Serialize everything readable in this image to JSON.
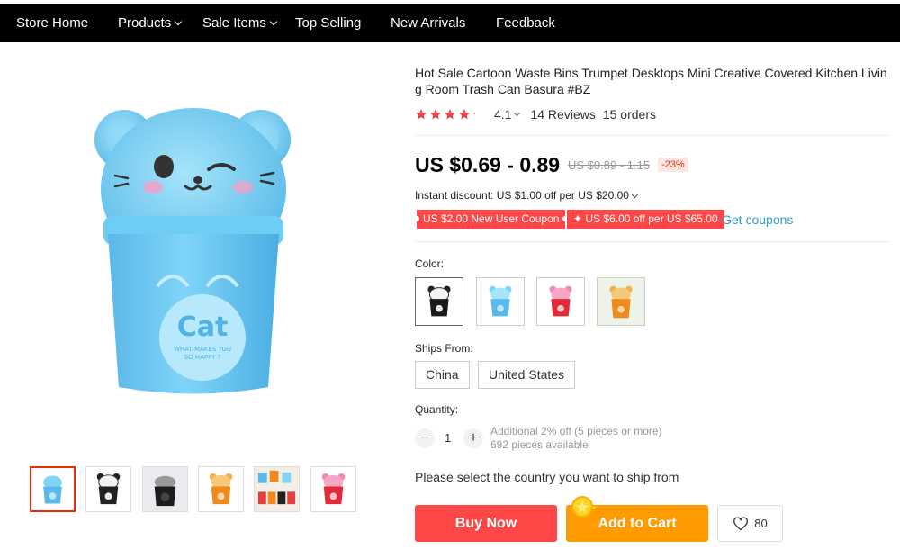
{
  "nav": {
    "items": [
      {
        "label": "Store Home",
        "dropdown": false
      },
      {
        "label": "Products",
        "dropdown": true
      },
      {
        "label": "Sale Items",
        "dropdown": true
      },
      {
        "label": "Top Selling",
        "dropdown": false
      },
      {
        "label": "New Arrivals",
        "dropdown": false
      },
      {
        "label": "Feedback",
        "dropdown": false
      }
    ]
  },
  "product": {
    "title": "Hot Sale Cartoon Waste Bins Trumpet Desktops Mini Creative Covered Kitchen Living Room Trash Can Basura #BZ",
    "rating": "4.1",
    "reviews": "14 Reviews",
    "orders": "15 orders",
    "price": "US $0.69 - 0.89",
    "original_price": "US $0.89 - 1.15",
    "discount": "-23%",
    "main_image_text": "Cat",
    "main_image_subtext": "WHAT MAKES YOU SO HAPPY ?"
  },
  "promo": {
    "instant_discount": "Instant discount: US $1.00 off per US $20.00",
    "coupon_new_user": "US $2.00 New User Coupon",
    "coupon_store": "✦ US $6.00 off per US $65.00",
    "get_coupons": "Get coupons"
  },
  "options": {
    "color_label": "Color:",
    "colors": [
      "black",
      "blue",
      "red",
      "orange"
    ],
    "ships_from_label": "Ships From:",
    "ships_from": [
      "China",
      "United States"
    ]
  },
  "quantity": {
    "label": "Quantity:",
    "value": "1",
    "minus": "−",
    "plus": "+",
    "bulk_info": "Additional 2% off (5 pieces or more)",
    "available": "692 pieces available"
  },
  "actions": {
    "ship_message": "Please select the country you want to ship from",
    "buy_now": "Buy Now",
    "add_to_cart": "Add to Cart",
    "wishlist_count": "80"
  },
  "thumbnails": [
    "blue",
    "black",
    "black-gray",
    "orange",
    "multi",
    "red"
  ],
  "colors": {
    "nav_bg": "#000000",
    "accent_red": "#ff4747",
    "cart_orange": "#ff9a00",
    "link_blue": "#2e9cc3",
    "star": "#f04040",
    "bin_blue": "#68c6f2"
  }
}
